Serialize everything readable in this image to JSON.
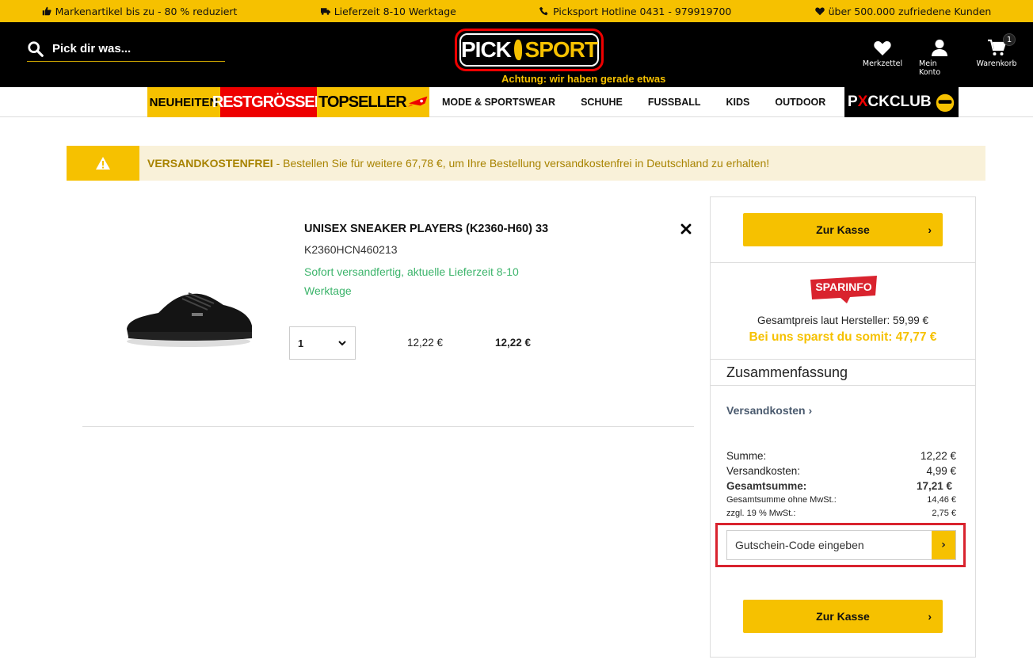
{
  "topbar": {
    "item1": "Markenartikel bis zu - 80 % reduziert",
    "item2": "Lieferzeit 8-10 Werktage",
    "item3": "Picksport Hotline 0431 - 979919700",
    "item4": "über 500.000 zufriedene Kunden"
  },
  "header": {
    "search_placeholder": "Pick dir was...",
    "logo_left": "PICK",
    "logo_right": "SPORT",
    "ticker": "Achtung: wir haben gerade etwas",
    "wishlist_label": "Merkzettel",
    "account_label": "Mein Konto",
    "cart_label": "Warenkorb",
    "cart_count": "1"
  },
  "nav": {
    "neuheiten": "NEUHEITEN",
    "restgroessen": "RESTGRÖSSEN",
    "topseller": "TOPSELLER",
    "links": [
      "MODE & SPORTSWEAR",
      "SCHUHE",
      "FUSSBALL",
      "KIDS",
      "OUTDOOR"
    ],
    "club_a": "P",
    "club_x": "X",
    "club_b": "CKCLUB"
  },
  "alert": {
    "strong": "VERSANDKOSTENFREI",
    "text": " - Bestellen Sie für weitere 67,78 €, um Ihre Bestellung versandkostenfrei in Deutschland zu erhalten!"
  },
  "product": {
    "title": "UNISEX SNEAKER PLAYERS (K2360-H60) 33",
    "sku": "K2360HCN460213",
    "stock": "Sofort versandfertig, aktuelle Lieferzeit 8-10 Werktage",
    "quantity": "1",
    "unit_price": "12,22 €",
    "total_price": "12,22 €"
  },
  "sidebar": {
    "checkout_label": "Zur Kasse",
    "sparinfo": "SPARINFO",
    "manufacturer_price": "Gesamtpreis laut Hersteller: 59,99 €",
    "savings": "Bei uns sparst du somit: 47,77 €",
    "summary_title": "Zusammenfassung",
    "shipping_link": "Versandkosten",
    "rows": [
      {
        "label": "Summe:",
        "value": "12,22 €"
      },
      {
        "label": "Versandkosten:",
        "value": "4,99 €"
      },
      {
        "label": "Gesamtsumme:",
        "value": "17,21 €"
      },
      {
        "label": "Gesamtsumme ohne MwSt.:",
        "value": "14,46 €"
      },
      {
        "label": "zzgl. 19 % MwSt.:",
        "value": "2,75 €"
      }
    ],
    "coupon_placeholder": "Gutschein-Code eingeben"
  },
  "colors": {
    "brand_yellow": "#f6c100",
    "brand_red": "#e00000",
    "stock_green": "#3cb46b",
    "highlight_red": "#d9232e"
  }
}
